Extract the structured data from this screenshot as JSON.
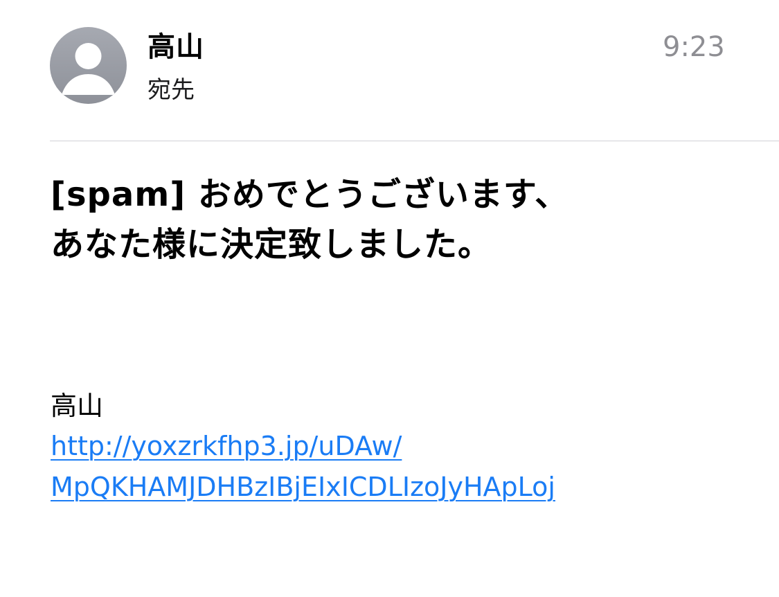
{
  "header": {
    "sender": "高山",
    "recipient_label": "宛先",
    "time": "9:23"
  },
  "subject": {
    "line1": "[spam] おめでとうございます、",
    "line2": "あなた様に決定致しました。"
  },
  "body": {
    "sender": "高山",
    "link_line1": "http://yoxzrkfhp3.jp/uDAw/",
    "link_line2": "MpQKHAMJDHBzIBjEIxICDLIzoJyHApLoj"
  },
  "colors": {
    "link": "#1a7cf5",
    "time": "#8e8e93",
    "avatar": "#9a9da5",
    "divider": "#d1d1d6"
  },
  "icons": {
    "avatar": "person-silhouette-icon"
  }
}
